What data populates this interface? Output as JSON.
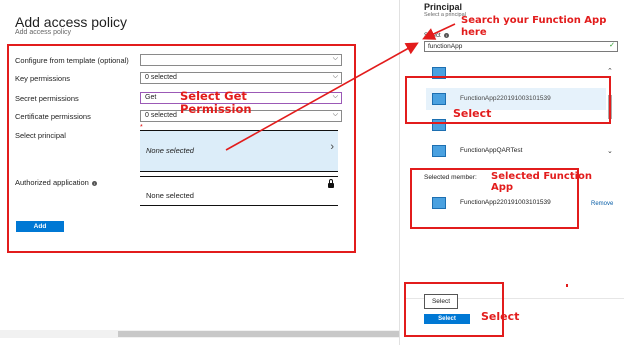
{
  "left_blade": {
    "title": "Add access policy",
    "subtitle": "Add access policy",
    "rows": {
      "template_label": "Configure from template (optional)",
      "template_value": "",
      "key_label": "Key permissions",
      "key_value": "0 selected",
      "secret_label": "Secret permissions",
      "secret_value": "Get",
      "cert_label": "Certificate permissions",
      "cert_value": "0 selected",
      "principal_label": "Select principal",
      "principal_value": "None selected",
      "auth_label": "Authorized application",
      "auth_value": "None selected"
    },
    "add_button": "Add"
  },
  "right_blade": {
    "title": "Principal",
    "subtitle": "Select a principal",
    "select_label": "Select",
    "search_value": "functionApp",
    "list": [
      {
        "label": ""
      },
      {
        "label": "FunctionApp220191003101539"
      },
      {
        "label": ""
      },
      {
        "label": "FunctionAppQARTest"
      }
    ],
    "selected_member_label": "Selected member:",
    "selected_member": "FunctionApp220191003101539",
    "remove_label": "Remove",
    "select_outline_btn": "Select",
    "select_primary_btn": "Select"
  },
  "annotations": {
    "select_get_permission": "Select Get Permission",
    "search_function_app": "Search your Function App here",
    "select_list": "Select",
    "selected_function_app": "Selected Function App",
    "select_bottom": "Select"
  },
  "colors": {
    "accent": "#0078d4",
    "annotation_red": "#e21c1c",
    "principal_bg": "#dcedf9"
  }
}
